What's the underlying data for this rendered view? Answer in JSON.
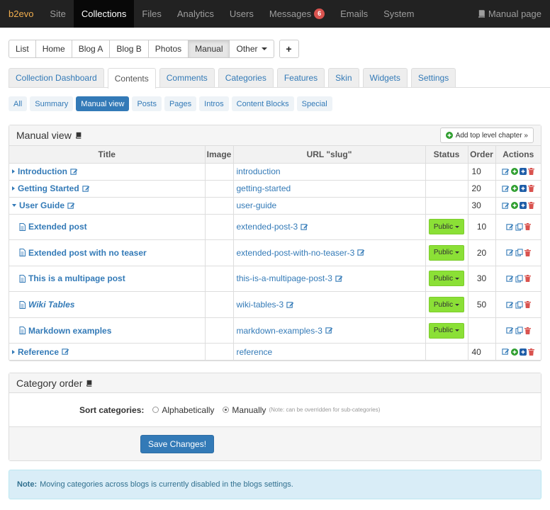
{
  "app": {
    "brand": "b2evo",
    "nav": [
      "Site",
      "Collections",
      "Files",
      "Analytics",
      "Users",
      "Messages",
      "Emails",
      "System"
    ],
    "messages_count": "6",
    "manual_page": "Manual page"
  },
  "collections": {
    "buttons": [
      "List",
      "Home",
      "Blog A",
      "Blog B",
      "Photos",
      "Manual"
    ],
    "other_label": "Other",
    "plus_label": "+"
  },
  "tabs": [
    "Collection Dashboard",
    "Contents",
    "Comments",
    "Categories",
    "Features",
    "Skin",
    "Widgets",
    "Settings"
  ],
  "subtabs": [
    "All",
    "Summary",
    "Manual view",
    "Posts",
    "Pages",
    "Intros",
    "Content Blocks",
    "Special"
  ],
  "manual": {
    "title": "Manual view",
    "add_chapter": "Add top level chapter »",
    "columns": [
      "Title",
      "Image",
      "URL \"slug\"",
      "Status",
      "Order",
      "Actions"
    ],
    "rows": [
      {
        "title": "Introduction",
        "slug": "introduction",
        "order": "10"
      },
      {
        "title": "Getting Started",
        "slug": "getting-started",
        "order": "20"
      },
      {
        "title": "User Guide",
        "slug": "user-guide",
        "order": "30"
      },
      {
        "title": "Extended post",
        "slug": "extended-post-3",
        "status": "Public",
        "order": "10"
      },
      {
        "title": "Extended post with no teaser",
        "slug": "extended-post-with-no-teaser-3",
        "status": "Public",
        "order": "20"
      },
      {
        "title": "This is a multipage post",
        "slug": "this-is-a-multipage-post-3",
        "status": "Public",
        "order": "30"
      },
      {
        "title": "Wiki Tables",
        "slug": "wiki-tables-3",
        "status": "Public",
        "order": "50"
      },
      {
        "title": "Markdown examples",
        "slug": "markdown-examples-3",
        "status": "Public",
        "order": ""
      },
      {
        "title": "Reference",
        "slug": "reference",
        "order": "40"
      }
    ]
  },
  "category_order": {
    "title": "Category order",
    "label": "Sort categories:",
    "option_alpha": "Alphabetically",
    "option_manual": "Manually",
    "note": "(Note: can be overridden for sub-categories)",
    "save": "Save Changes!"
  },
  "alert": {
    "label": "Note:",
    "text": "Moving categories across blogs is currently disabled in the blogs settings."
  },
  "colors": {
    "navbar": "#222222",
    "brand": "#f0ad4e",
    "link": "#337ab7",
    "public_status": "#8be036",
    "badge": "#d9534f",
    "alert_bg": "#d9edf7"
  }
}
